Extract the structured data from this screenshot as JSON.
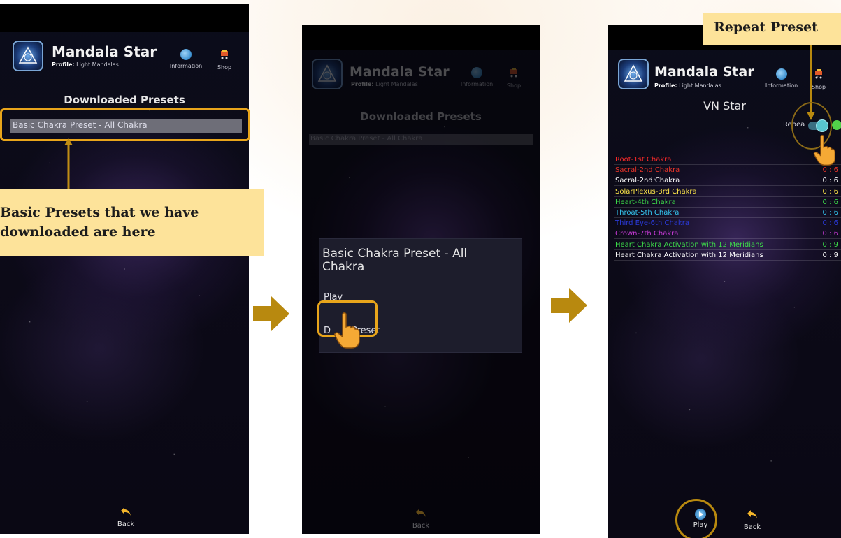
{
  "app": {
    "title": "Mandala Star",
    "profile_label": "Profile:",
    "profile_value": "Light Mandalas",
    "information_label": "Information",
    "shop_label": "Shop",
    "back_label": "Back"
  },
  "screen1": {
    "section_title": "Downloaded Presets",
    "preset_item": "Basic Chakra Preset - All Chakra",
    "note_line1": "Basic Presets that we have",
    "note_line2": "downloaded are here"
  },
  "screen2": {
    "section_title": "Downloaded Presets",
    "preset_item": "Basic Chakra Preset - All Chakra",
    "dialog_title_line1": "Basic Chakra Preset - All",
    "dialog_title_line2": "Chakra",
    "dialog_play": "Play",
    "dialog_delete_prefix": "D",
    "dialog_delete_suffix": "Preset"
  },
  "screen3": {
    "preset_name": "VN Star",
    "repeat_label": "Repea",
    "note": "Repeat Preset",
    "play_label": "Play",
    "tracks": [
      {
        "name": "Root-1st Chakra",
        "duration": "",
        "color": "#ff2a2a"
      },
      {
        "name": "Sacral-2nd Chakra",
        "duration": "0 : 6",
        "color": "#e8342a"
      },
      {
        "name": "Sacral-2nd Chakra",
        "duration": "0 : 6",
        "color": "#ffffff"
      },
      {
        "name": "SolarPlexus-3rd Chakra",
        "duration": "0 : 6",
        "color": "#ffe84a"
      },
      {
        "name": "Heart-4th Chakra",
        "duration": "0 : 6",
        "color": "#3ddc4a"
      },
      {
        "name": "Throat-5th Chakra",
        "duration": "0 : 6",
        "color": "#35c7f2"
      },
      {
        "name": "Third Eye-6th Chakra",
        "duration": "0 : 6",
        "color": "#2a3ad8"
      },
      {
        "name": "Crown-7th Chakra",
        "duration": "0 : 6",
        "color": "#c93ad8"
      },
      {
        "name": "Heart Chakra Activation with 12 Meridians",
        "duration": "0 : 9",
        "color": "#3ddc4a"
      },
      {
        "name": "Heart Chakra Activation with 12 Meridians",
        "duration": "0 : 9",
        "color": "#ffffff"
      }
    ]
  },
  "colors": {
    "callout": "#e8a51b",
    "note_bg": "#fde39a",
    "arrow": "#b8890f"
  }
}
